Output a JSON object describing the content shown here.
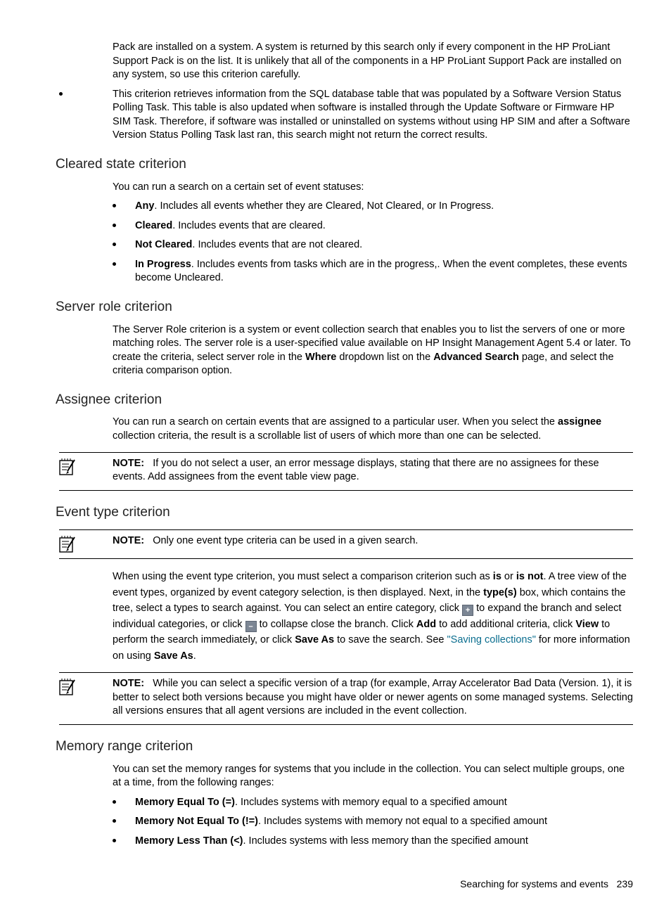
{
  "intro": {
    "p1": "Pack are installed on a system. A system is returned by this search only if every component in the HP ProLiant Support Pack is on the list. It is unlikely that all of the components in a HP ProLiant Support Pack are installed on any system, so use this criterion carefully.",
    "p2": "This criterion retrieves information from the SQL database table that was populated by a Software Version Status Polling Task. This table is also updated when software is installed through the Update Software or Firmware HP SIM Task. Therefore, if software was installed or uninstalled on systems without using HP SIM and after a Software Version Status Polling Task last ran, this search might not return the correct results."
  },
  "s1": {
    "h": "Cleared state criterion",
    "lead": "You can run a search on a certain set of event statuses:",
    "items": [
      {
        "t": "Any",
        "d": ". Includes all events whether they are Cleared, Not Cleared, or In Progress."
      },
      {
        "t": "Cleared",
        "d": ". Includes events that are cleared."
      },
      {
        "t": "Not Cleared",
        "d": ". Includes events that are not cleared."
      },
      {
        "t": "In Progress",
        "d": ". Includes events from tasks which are in the progress,. When the event completes, these events become Uncleared."
      }
    ]
  },
  "s2": {
    "h": "Server role criterion",
    "p_a": "The Server Role criterion is a system or event collection search that enables you to list the servers of one or more matching roles. The server role is a user-specified value available on HP Insight Management Agent 5.4 or later. To create the criteria, select server role in the ",
    "p_b": "Where",
    "p_c": " dropdown list on the ",
    "p_d": "Advanced Search",
    "p_e": " page, and select the criteria comparison option."
  },
  "s3": {
    "h": "Assignee criterion",
    "p_a": "You can run a search on certain events that are assigned to a particular user. When you select the ",
    "p_b": "assignee",
    "p_c": " collection criteria, the result is a scrollable list of users of which more than one can be selected.",
    "note_label": "NOTE:",
    "note": "If you do not select a user, an error message displays, stating that there are no assignees for these events. Add assignees from the event table view page."
  },
  "s4": {
    "h": "Event type criterion",
    "note1_label": "NOTE:",
    "note1": "Only one event type criteria can be used in a given search.",
    "p": {
      "a": "When using the event type criterion, you must select a comparison criterion such as ",
      "b": "is",
      "c": " or ",
      "d": "is not",
      "e": ". A tree view of the event types, organized by event category selection, is then displayed. Next, in the ",
      "f": "type(s)",
      "g": " box, which contains the tree, select a types to search against. You can select an entire category, click ",
      "plus": "+",
      "h": " to expand the branch and select individual categories, or click ",
      "minus": "–",
      "i": " to collapse close the branch. Click ",
      "j": "Add",
      "k": " to add additional criteria, click ",
      "l": "View",
      "m": " to perform the search immediately, or click ",
      "n": "Save As",
      "o": " to save the search. See ",
      "link": "\"Saving collections\"",
      "q": " for more information on using ",
      "r": "Save As",
      "s": "."
    },
    "note2_label": "NOTE:",
    "note2": "While you can select a specific version of a trap (for example, Array Accelerator Bad Data (Version. 1), it is better to select both versions because you might have older or newer agents on some managed systems. Selecting all versions ensures that all agent versions are included in the event collection."
  },
  "s5": {
    "h": "Memory range criterion",
    "lead": "You can set the memory ranges for systems that you include in the collection. You can select multiple groups, one at a time, from the following ranges:",
    "items": [
      {
        "t": "Memory Equal To (=)",
        "d": ". Includes systems with memory equal to a specified amount"
      },
      {
        "t": "Memory Not Equal To (!=)",
        "d": ". Includes systems with memory not equal to a specified amount"
      },
      {
        "t": "Memory Less Than (<)",
        "d": ". Includes systems with less memory than the specified amount"
      }
    ]
  },
  "footer": {
    "title": "Searching for systems and events",
    "page": "239"
  }
}
